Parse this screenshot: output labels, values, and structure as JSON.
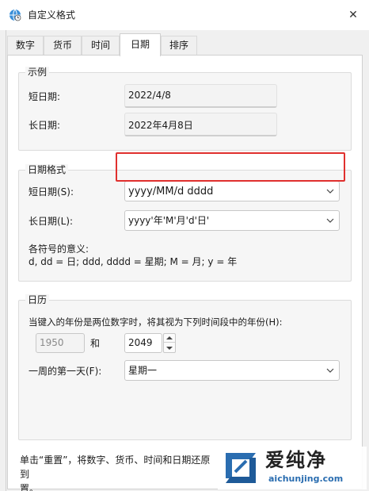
{
  "window": {
    "title": "自定义格式",
    "close_glyph": "✕"
  },
  "tabs": [
    {
      "label": "数字"
    },
    {
      "label": "货币"
    },
    {
      "label": "时间"
    },
    {
      "label": "日期"
    },
    {
      "label": "排序"
    }
  ],
  "active_tab": "日期",
  "example": {
    "title": "示例",
    "short_label": "短日期:",
    "short_value": "2022/4/8",
    "long_label": "长日期:",
    "long_value": "2022年4月8日"
  },
  "date_format": {
    "title": "日期格式",
    "short_label": "短日期(S):",
    "short_value": "yyyy/MM/d dddd",
    "long_label": "长日期(L):",
    "long_value": "yyyy'年'M'月'd'日'",
    "legend_title": "各符号的意义:",
    "legend_text": "d, dd = 日;  ddd, dddd = 星期;  M = 月;  y = 年"
  },
  "calendar": {
    "title": "日历",
    "two_digit_label": "当键入的年份是两位数字时，将其视为下列时间段中的年份(H):",
    "year_from": "1950",
    "and_label": "和",
    "year_to": "2049",
    "first_day_label": "一周的第一天(F):",
    "first_day_value": "星期一"
  },
  "footer": {
    "line1": "单击“重置”，将数字、货币、时间和日期还原到",
    "line2": "置。"
  },
  "watermark": {
    "title": "爱纯净",
    "url": "aichunjing.com"
  },
  "colors": {
    "highlight": "#e0302e",
    "accent": "#2a6db0"
  }
}
